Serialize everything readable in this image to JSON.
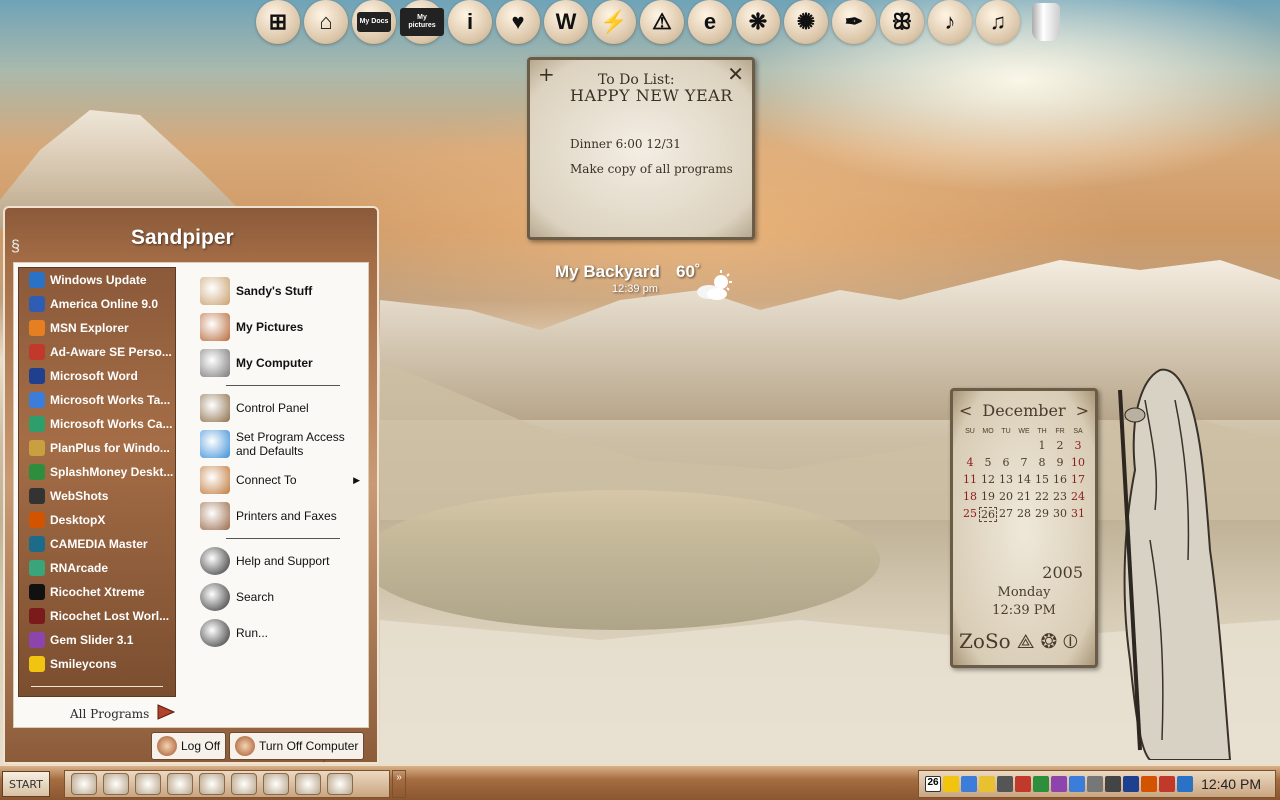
{
  "dock": {
    "icons": [
      {
        "name": "windows-logo-icon",
        "glyph": "⊞"
      },
      {
        "name": "home-icon",
        "glyph": "⌂"
      },
      {
        "name": "my-docs-icon",
        "label": "My Docs"
      },
      {
        "name": "my-pictures-icon",
        "label": "My pictures"
      },
      {
        "name": "info-icon",
        "glyph": "i"
      },
      {
        "name": "heart-icon",
        "glyph": "♥"
      },
      {
        "name": "w-icon",
        "glyph": "W"
      },
      {
        "name": "lightning-icon",
        "glyph": "⚡"
      },
      {
        "name": "warning-icon",
        "glyph": "⚠"
      },
      {
        "name": "internet-explorer-icon",
        "glyph": "e"
      },
      {
        "name": "chat-bubble-icon",
        "glyph": "❋"
      },
      {
        "name": "flower-icon",
        "glyph": "✺"
      },
      {
        "name": "feather-icon",
        "glyph": "✒"
      },
      {
        "name": "butterfly-icon",
        "glyph": "ꕥ"
      },
      {
        "name": "music-note-icon",
        "glyph": "♪"
      },
      {
        "name": "double-note-icon",
        "glyph": "♫"
      },
      {
        "name": "recycle-bin-icon",
        "glyph": ""
      }
    ]
  },
  "todo": {
    "title": "To Do List:",
    "line1": "HAPPY NEW YEAR",
    "line2": "Dinner 6:00 12/31",
    "line3": "Make copy of all programs",
    "plus": "+",
    "close": "✕"
  },
  "weather": {
    "location": "My Backyard",
    "temperature": "60˚",
    "time": "12:39 pm"
  },
  "calendar": {
    "month": "December",
    "prev": "<",
    "next": ">",
    "weekdays": [
      "SU",
      "MO",
      "TU",
      "WE",
      "TH",
      "FR",
      "SA"
    ],
    "days": [
      "",
      "",
      "",
      "",
      "1",
      "2",
      "3",
      "4",
      "5",
      "6",
      "7",
      "8",
      "9",
      "10",
      "11",
      "12",
      "13",
      "14",
      "15",
      "16",
      "17",
      "18",
      "19",
      "20",
      "21",
      "22",
      "23",
      "24",
      "25",
      "26",
      "27",
      "28",
      "29",
      "30",
      "31"
    ],
    "today": "26",
    "year": "2005",
    "dayname": "Monday",
    "time": "12:39 PM",
    "symbols": [
      "ZoSo",
      "⟁",
      "❂",
      "⦶"
    ]
  },
  "startmenu": {
    "user": "Sandpiper",
    "programs": [
      {
        "label": "Windows Update",
        "color": "#2a72c6",
        "icon": "globe-update-icon"
      },
      {
        "label": "America Online 9.0",
        "color": "#2f5db4",
        "icon": "aol-icon"
      },
      {
        "label": "MSN Explorer",
        "color": "#e67e22",
        "icon": "msn-butterfly-icon"
      },
      {
        "label": "Ad-Aware SE Perso...",
        "color": "#c0392b",
        "icon": "adaware-icon"
      },
      {
        "label": "Microsoft Word",
        "color": "#1f3f8f",
        "icon": "word-icon"
      },
      {
        "label": "Microsoft Works Ta...",
        "color": "#3b7dd8",
        "icon": "works-task-icon"
      },
      {
        "label": "Microsoft Works Ca...",
        "color": "#2e9e6a",
        "icon": "works-calendar-icon"
      },
      {
        "label": "PlanPlus for Windo...",
        "color": "#c8a040",
        "icon": "planplus-icon"
      },
      {
        "label": "SplashMoney Deskt...",
        "color": "#2d8f3e",
        "icon": "splashmoney-icon"
      },
      {
        "label": "WebShots",
        "color": "#333333",
        "icon": "camera-icon"
      },
      {
        "label": "DesktopX",
        "color": "#d35400",
        "icon": "desktopx-icon"
      },
      {
        "label": "CAMEDIA Master",
        "color": "#1c6b8a",
        "icon": "camedia-icon"
      },
      {
        "label": "RNArcade",
        "color": "#3aa57a",
        "icon": "rnarcade-icon"
      },
      {
        "label": "Ricochet Xtreme",
        "color": "#111111",
        "icon": "ricochet-icon"
      },
      {
        "label": "Ricochet Lost Worl...",
        "color": "#7a1a1a",
        "icon": "ricochet-lost-icon"
      },
      {
        "label": "Gem Slider 3.1",
        "color": "#8e44ad",
        "icon": "gem-icon"
      },
      {
        "label": "Smileycons",
        "color": "#f1c40f",
        "icon": "smiley-icon"
      }
    ],
    "all_programs": "All Programs",
    "places_top": [
      {
        "label": "Sandy's Stuff",
        "icon": "user-folder-icon"
      },
      {
        "label": "My Pictures",
        "icon": "pictures-folder-icon"
      },
      {
        "label": "My Computer",
        "icon": "computer-icon"
      }
    ],
    "places_mid": [
      {
        "label": "Control Panel",
        "icon": "control-panel-icon"
      },
      {
        "label": "Set Program Access and Defaults",
        "icon": "program-access-icon"
      },
      {
        "label": "Connect To",
        "icon": "connect-icon"
      },
      {
        "label": "Printers and Faxes",
        "icon": "printer-icon"
      }
    ],
    "places_bottom": [
      {
        "label": "Help and Support",
        "icon": "help-icon"
      },
      {
        "label": "Search",
        "icon": "search-icon"
      },
      {
        "label": "Run...",
        "icon": "run-icon"
      }
    ],
    "log_off": "Log Off",
    "turn_off": "Turn Off Computer"
  },
  "taskbar": {
    "start": "START",
    "quicklaunch_count": 9,
    "chevron": "»",
    "clock": "12:40 PM",
    "tray_badge": "26"
  },
  "colors": {
    "accent": "#a46d46",
    "panel": "#fbf9f6",
    "scroll": "#e6ddcc"
  }
}
